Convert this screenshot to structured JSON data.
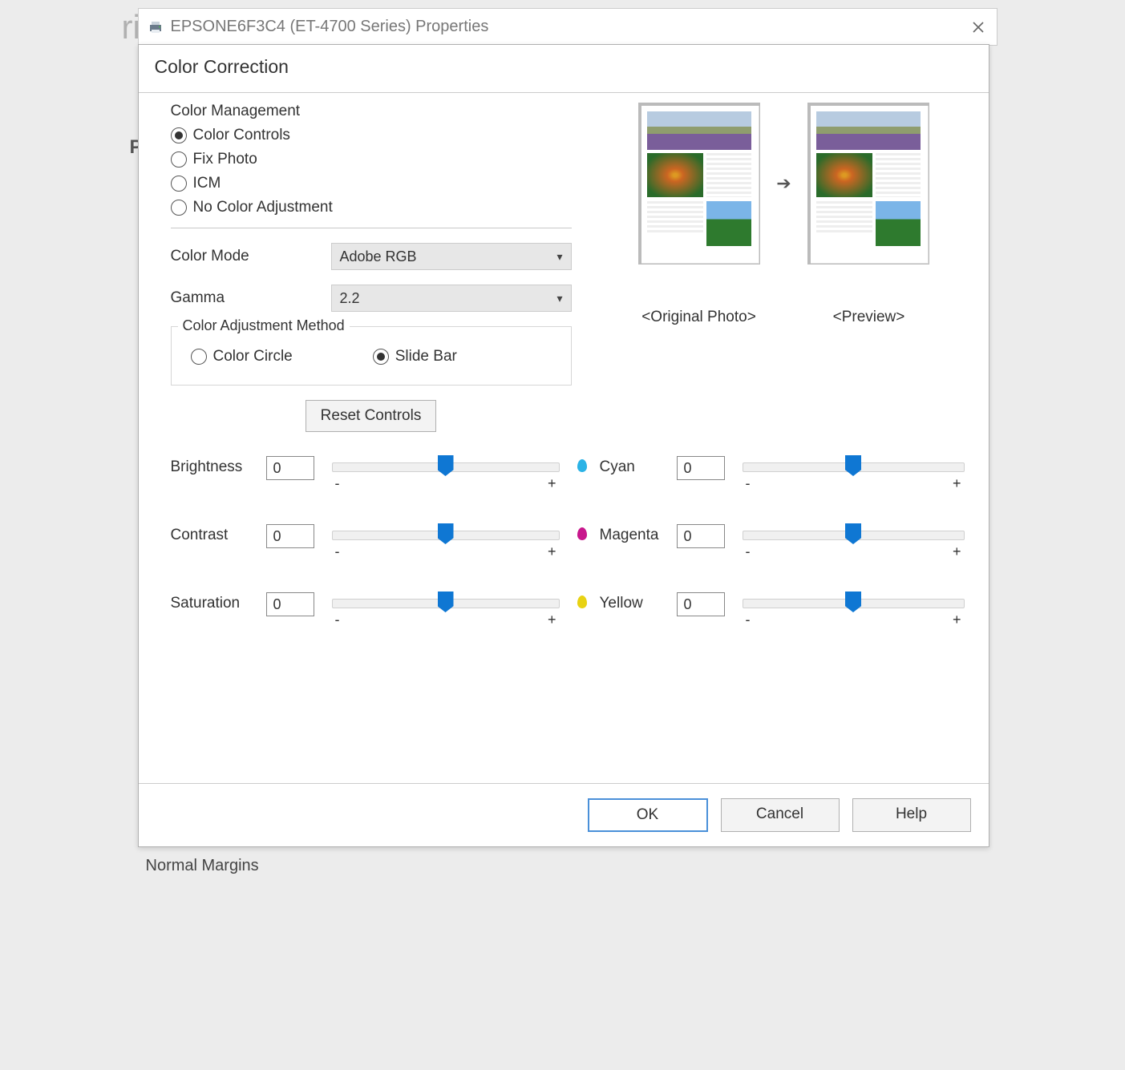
{
  "window_title": "EPSONE6F3C4 (ET-4700 Series) Properties",
  "dialog_title": "Color Correction",
  "bg_label": "Normal Margins",
  "color_management": {
    "group_label": "Color Management",
    "options": {
      "color_controls": "Color Controls",
      "fix_photo": "Fix Photo",
      "icm": "ICM",
      "no_adjust": "No Color Adjustment"
    },
    "selected": "color_controls"
  },
  "color_mode": {
    "label": "Color Mode",
    "value": "Adobe RGB"
  },
  "gamma": {
    "label": "Gamma",
    "value": "2.2"
  },
  "adjust_method": {
    "legend": "Color Adjustment Method",
    "options": {
      "circle": "Color Circle",
      "slide": "Slide Bar"
    },
    "selected": "slide"
  },
  "reset_label": "Reset Controls",
  "previews": {
    "original": "<Original Photo>",
    "preview": "<Preview>"
  },
  "sliders": {
    "brightness": {
      "label": "Brightness",
      "value": "0"
    },
    "contrast": {
      "label": "Contrast",
      "value": "0"
    },
    "saturation": {
      "label": "Saturation",
      "value": "0"
    },
    "cyan": {
      "label": "Cyan",
      "value": "0",
      "color": "#2bb3e6"
    },
    "magenta": {
      "label": "Magenta",
      "value": "0",
      "color": "#c8178c"
    },
    "yellow": {
      "label": "Yellow",
      "value": "0",
      "color": "#e8d213"
    }
  },
  "pm": {
    "minus": "-",
    "plus": "+"
  },
  "buttons": {
    "ok": "OK",
    "cancel": "Cancel",
    "help": "Help"
  }
}
